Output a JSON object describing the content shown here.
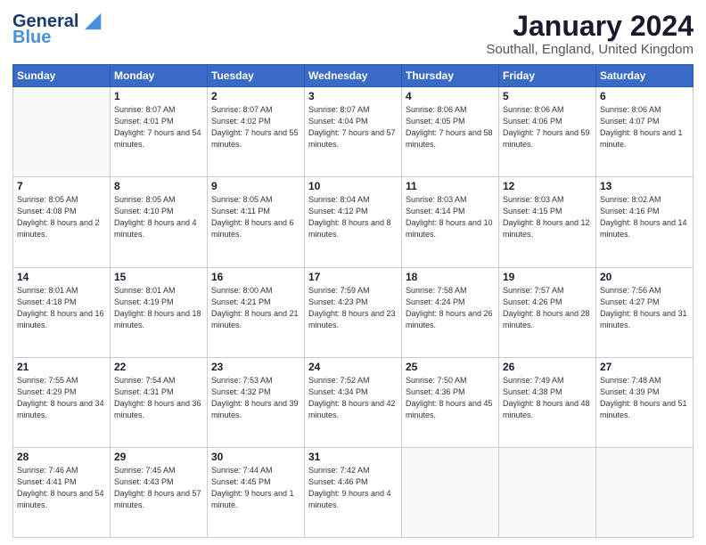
{
  "header": {
    "logo_line1": "General",
    "logo_line2": "Blue",
    "month": "January 2024",
    "location": "Southall, England, United Kingdom"
  },
  "days_of_week": [
    "Sunday",
    "Monday",
    "Tuesday",
    "Wednesday",
    "Thursday",
    "Friday",
    "Saturday"
  ],
  "weeks": [
    [
      {
        "day": "",
        "info": ""
      },
      {
        "day": "1",
        "info": "Sunrise: 8:07 AM\nSunset: 4:01 PM\nDaylight: 7 hours\nand 54 minutes."
      },
      {
        "day": "2",
        "info": "Sunrise: 8:07 AM\nSunset: 4:02 PM\nDaylight: 7 hours\nand 55 minutes."
      },
      {
        "day": "3",
        "info": "Sunrise: 8:07 AM\nSunset: 4:04 PM\nDaylight: 7 hours\nand 57 minutes."
      },
      {
        "day": "4",
        "info": "Sunrise: 8:06 AM\nSunset: 4:05 PM\nDaylight: 7 hours\nand 58 minutes."
      },
      {
        "day": "5",
        "info": "Sunrise: 8:06 AM\nSunset: 4:06 PM\nDaylight: 7 hours\nand 59 minutes."
      },
      {
        "day": "6",
        "info": "Sunrise: 8:06 AM\nSunset: 4:07 PM\nDaylight: 8 hours\nand 1 minute."
      }
    ],
    [
      {
        "day": "7",
        "info": "Sunrise: 8:05 AM\nSunset: 4:08 PM\nDaylight: 8 hours\nand 2 minutes."
      },
      {
        "day": "8",
        "info": "Sunrise: 8:05 AM\nSunset: 4:10 PM\nDaylight: 8 hours\nand 4 minutes."
      },
      {
        "day": "9",
        "info": "Sunrise: 8:05 AM\nSunset: 4:11 PM\nDaylight: 8 hours\nand 6 minutes."
      },
      {
        "day": "10",
        "info": "Sunrise: 8:04 AM\nSunset: 4:12 PM\nDaylight: 8 hours\nand 8 minutes."
      },
      {
        "day": "11",
        "info": "Sunrise: 8:03 AM\nSunset: 4:14 PM\nDaylight: 8 hours\nand 10 minutes."
      },
      {
        "day": "12",
        "info": "Sunrise: 8:03 AM\nSunset: 4:15 PM\nDaylight: 8 hours\nand 12 minutes."
      },
      {
        "day": "13",
        "info": "Sunrise: 8:02 AM\nSunset: 4:16 PM\nDaylight: 8 hours\nand 14 minutes."
      }
    ],
    [
      {
        "day": "14",
        "info": "Sunrise: 8:01 AM\nSunset: 4:18 PM\nDaylight: 8 hours\nand 16 minutes."
      },
      {
        "day": "15",
        "info": "Sunrise: 8:01 AM\nSunset: 4:19 PM\nDaylight: 8 hours\nand 18 minutes."
      },
      {
        "day": "16",
        "info": "Sunrise: 8:00 AM\nSunset: 4:21 PM\nDaylight: 8 hours\nand 21 minutes."
      },
      {
        "day": "17",
        "info": "Sunrise: 7:59 AM\nSunset: 4:23 PM\nDaylight: 8 hours\nand 23 minutes."
      },
      {
        "day": "18",
        "info": "Sunrise: 7:58 AM\nSunset: 4:24 PM\nDaylight: 8 hours\nand 26 minutes."
      },
      {
        "day": "19",
        "info": "Sunrise: 7:57 AM\nSunset: 4:26 PM\nDaylight: 8 hours\nand 28 minutes."
      },
      {
        "day": "20",
        "info": "Sunrise: 7:56 AM\nSunset: 4:27 PM\nDaylight: 8 hours\nand 31 minutes."
      }
    ],
    [
      {
        "day": "21",
        "info": "Sunrise: 7:55 AM\nSunset: 4:29 PM\nDaylight: 8 hours\nand 34 minutes."
      },
      {
        "day": "22",
        "info": "Sunrise: 7:54 AM\nSunset: 4:31 PM\nDaylight: 8 hours\nand 36 minutes."
      },
      {
        "day": "23",
        "info": "Sunrise: 7:53 AM\nSunset: 4:32 PM\nDaylight: 8 hours\nand 39 minutes."
      },
      {
        "day": "24",
        "info": "Sunrise: 7:52 AM\nSunset: 4:34 PM\nDaylight: 8 hours\nand 42 minutes."
      },
      {
        "day": "25",
        "info": "Sunrise: 7:50 AM\nSunset: 4:36 PM\nDaylight: 8 hours\nand 45 minutes."
      },
      {
        "day": "26",
        "info": "Sunrise: 7:49 AM\nSunset: 4:38 PM\nDaylight: 8 hours\nand 48 minutes."
      },
      {
        "day": "27",
        "info": "Sunrise: 7:48 AM\nSunset: 4:39 PM\nDaylight: 8 hours\nand 51 minutes."
      }
    ],
    [
      {
        "day": "28",
        "info": "Sunrise: 7:46 AM\nSunset: 4:41 PM\nDaylight: 8 hours\nand 54 minutes."
      },
      {
        "day": "29",
        "info": "Sunrise: 7:45 AM\nSunset: 4:43 PM\nDaylight: 8 hours\nand 57 minutes."
      },
      {
        "day": "30",
        "info": "Sunrise: 7:44 AM\nSunset: 4:45 PM\nDaylight: 9 hours\nand 1 minute."
      },
      {
        "day": "31",
        "info": "Sunrise: 7:42 AM\nSunset: 4:46 PM\nDaylight: 9 hours\nand 4 minutes."
      },
      {
        "day": "",
        "info": ""
      },
      {
        "day": "",
        "info": ""
      },
      {
        "day": "",
        "info": ""
      }
    ]
  ]
}
